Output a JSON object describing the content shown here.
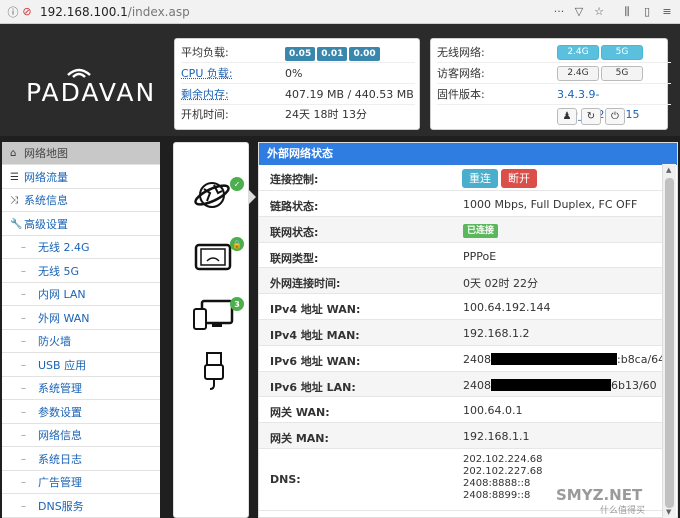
{
  "browser": {
    "url_host": "192.168.100.1",
    "url_path": "/index.asp"
  },
  "brand": {
    "logo_text": "PADAVAN"
  },
  "system": {
    "rows": [
      {
        "label": "平均负载:",
        "value": "",
        "badges": [
          "0.05",
          "0.01",
          "0.00"
        ]
      },
      {
        "label": "CPU 负载:",
        "value": "0%"
      },
      {
        "label": "剩余内存:",
        "value": "407.19 MB / 440.53 MB"
      },
      {
        "label": "开机时间:",
        "value": "24天 18时 13分"
      }
    ]
  },
  "network": {
    "rows": [
      {
        "label": "无线网络:",
        "btn1": "2.4G",
        "btn2": "5G"
      },
      {
        "label": "访客网络:",
        "btn1": "2.4G",
        "btn2": "5G"
      },
      {
        "label": "固件版本:",
        "value": "3.4.3.9-099_20201015"
      }
    ]
  },
  "menu": {
    "items": [
      {
        "label": "网络地图",
        "icon": "home-icon",
        "glyph": "⌂",
        "sub": false,
        "active": true
      },
      {
        "label": "网络流量",
        "icon": "list-icon",
        "glyph": "☰",
        "sub": false
      },
      {
        "label": "系统信息",
        "icon": "shuffle-icon",
        "glyph": "⤨",
        "sub": false
      },
      {
        "label": "高级设置",
        "icon": "wrench-icon",
        "glyph": "🔧",
        "sub": false
      },
      {
        "label": "无线 2.4G",
        "sub": true
      },
      {
        "label": "无线 5G",
        "sub": true
      },
      {
        "label": "内网 LAN",
        "sub": true
      },
      {
        "label": "外网 WAN",
        "sub": true
      },
      {
        "label": "防火墙",
        "sub": true
      },
      {
        "label": "USB 应用",
        "sub": true
      },
      {
        "label": "系统管理",
        "sub": true
      },
      {
        "label": "参数设置",
        "sub": true
      },
      {
        "label": "网络信息",
        "sub": true
      },
      {
        "label": "系统日志",
        "sub": true
      },
      {
        "label": "广告管理",
        "sub": true
      },
      {
        "label": "DNS服务",
        "sub": true
      }
    ]
  },
  "status_icons": {
    "clients_count": "3"
  },
  "wan": {
    "title": "外部网络状态",
    "connect_label": "连接控制:",
    "reconnect_btn": "重连",
    "disconnect_btn": "断开",
    "rows": [
      {
        "label": "链路状态:",
        "value": "1000 Mbps, Full Duplex, FC OFF"
      },
      {
        "label": "联网状态:",
        "badge": "已连接"
      },
      {
        "label": "联网类型:",
        "value": "PPPoE"
      },
      {
        "label": "外网连接时间:",
        "value": "0天 02时 22分"
      },
      {
        "label": "IPv4 地址 WAN:",
        "value": "100.64.192.144"
      },
      {
        "label": "IPv4 地址 MAN:",
        "value": "192.168.1.2"
      },
      {
        "label": "IPv6 地址 WAN:",
        "value_pre": "2408:8",
        "value_post": ":b8ca/64"
      },
      {
        "label": "IPv6 地址 LAN:",
        "value_pre": "2408:8",
        "value_post": "6b13/60"
      },
      {
        "label": "网关 WAN:",
        "value": "100.64.0.1"
      },
      {
        "label": "网关 MAN:",
        "value": "192.168.1.1"
      },
      {
        "label": "DNS:",
        "dns": [
          "202.102.224.68",
          "202.102.227.68",
          "2408:8888::8",
          "2408:8899::8"
        ]
      }
    ]
  },
  "watermark": {
    "main": "SMYZ.NET",
    "sub": "什么值得买"
  }
}
